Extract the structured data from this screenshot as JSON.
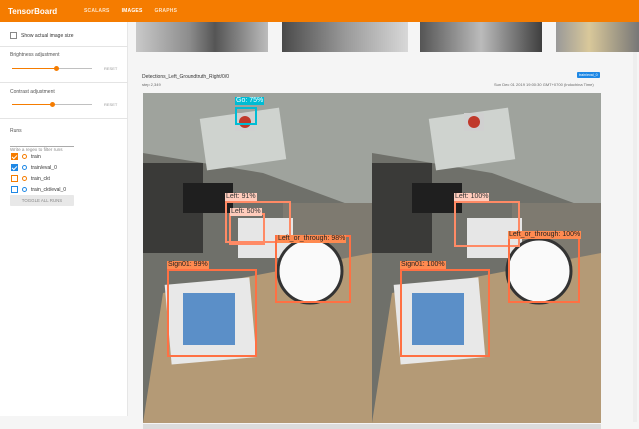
{
  "app": {
    "brand": "TensorBoard",
    "tabs": [
      "SCALARS",
      "IMAGES",
      "GRAPHS"
    ],
    "active_tab_index": 1,
    "accent_color": "#f57c00"
  },
  "sidebar": {
    "show_actual_size_label": "Show actual image size",
    "show_actual_size_checked": false,
    "brightness": {
      "label": "Brightness adjustment",
      "reset_label": "RESET",
      "value_fraction": 0.55
    },
    "contrast": {
      "label": "Contrast adjustment",
      "reset_label": "RESET",
      "value_fraction": 0.5
    },
    "runs": {
      "heading": "Runs",
      "filter_placeholder": "Write a regex to filter runs",
      "items": [
        {
          "label": "train",
          "checked": true,
          "color": "#f57c00"
        },
        {
          "label": "train/eval_0",
          "checked": true,
          "color": "#1e88e5"
        },
        {
          "label": "train_ckt",
          "checked": false,
          "color": "#f57c00"
        },
        {
          "label": "train_ckt/eval_0",
          "checked": false,
          "color": "#1e88e5"
        }
      ],
      "toggle_all_label": "TOGGLE ALL RUNS"
    }
  },
  "card": {
    "title": "Detections_Left_Groundtruth_Right/0/0",
    "step": "step 2,349",
    "timestamp": "Sun Dec 01 2019 19:00:30 GMT+0700 (Indochina Time)",
    "badge": "train/eval_0"
  },
  "left_detections": [
    {
      "label": "Go: 75%",
      "color": "#00bcd4"
    },
    {
      "label": "Left: 91%",
      "color": "#ff8a65"
    },
    {
      "label": "Left: 50%",
      "color": "#ff8a65"
    },
    {
      "label": "Left_or_through: 98%",
      "color": "#ff7043"
    },
    {
      "label": "Sign01: 99%",
      "color": "#ff7043"
    }
  ],
  "right_detections": [
    {
      "label": "Left: 100%",
      "color": "#ff8a65"
    },
    {
      "label": "Left_or_through: 100%",
      "color": "#ff7043"
    },
    {
      "label": "Sign01: 100%",
      "color": "#ff7043"
    }
  ]
}
